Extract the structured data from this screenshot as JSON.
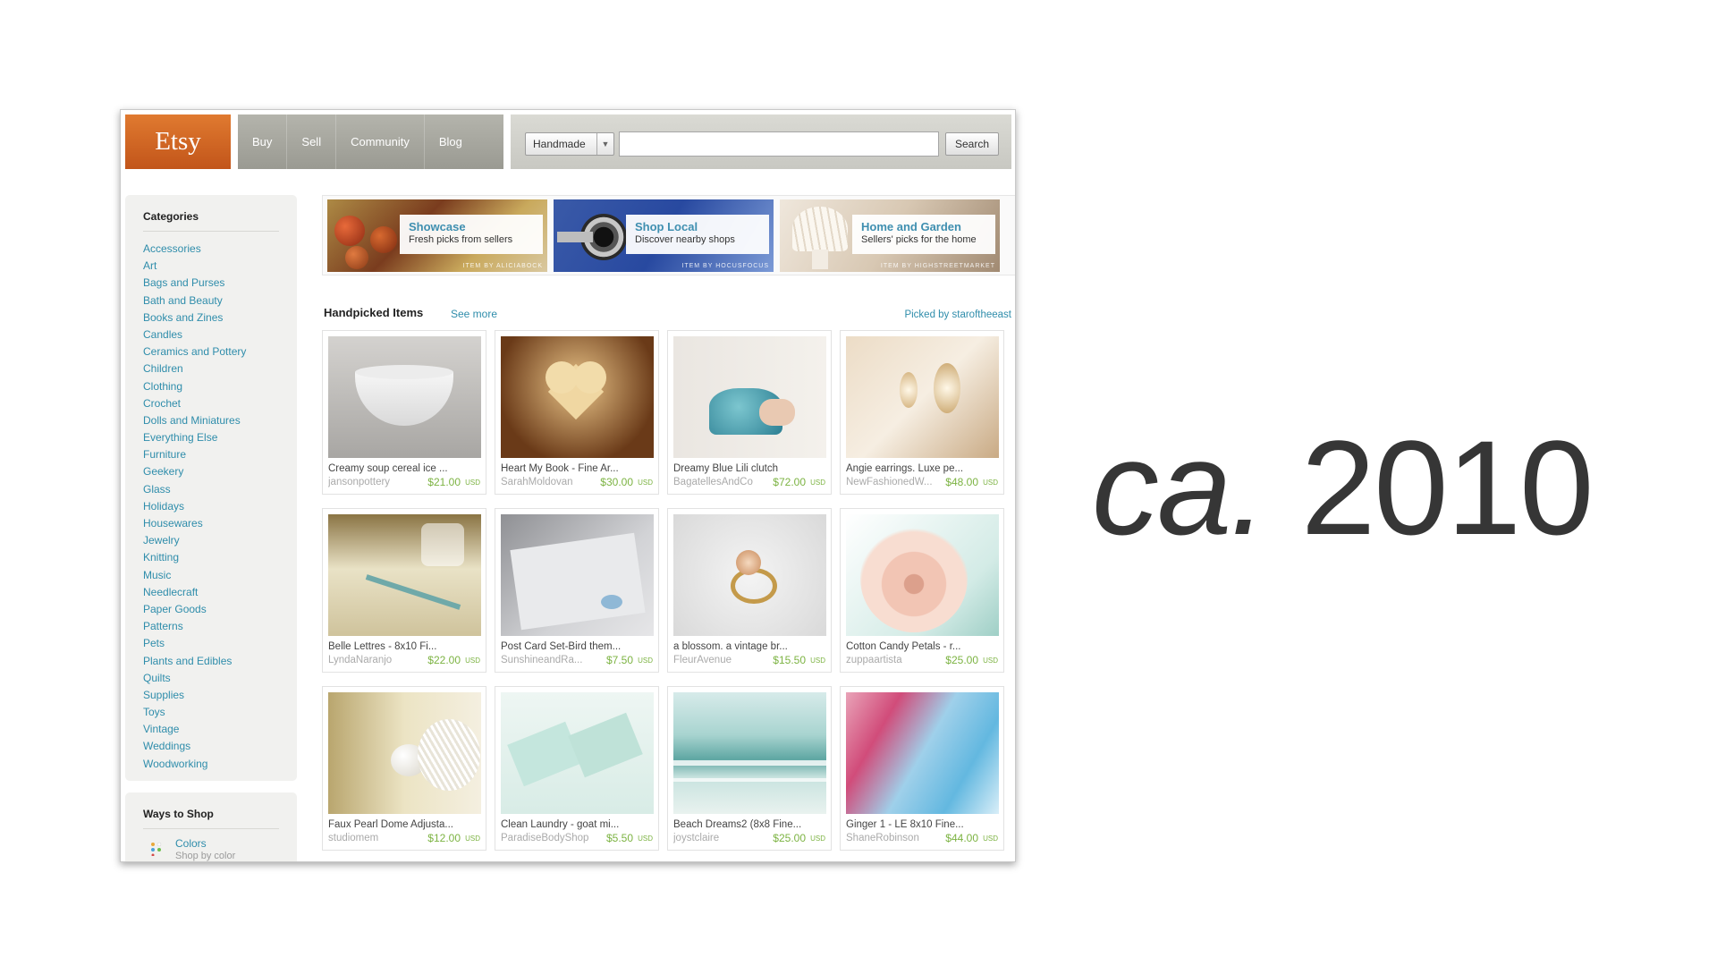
{
  "header": {
    "logo": "Etsy",
    "nav": [
      "Buy",
      "Sell",
      "Community",
      "Blog"
    ],
    "search_select": "Handmade",
    "search_value": "",
    "search_button": "Search"
  },
  "sidebar": {
    "categories_title": "Categories",
    "categories": [
      "Accessories",
      "Art",
      "Bags and Purses",
      "Bath and Beauty",
      "Books and Zines",
      "Candles",
      "Ceramics and Pottery",
      "Children",
      "Clothing",
      "Crochet",
      "Dolls and Miniatures",
      "Everything Else",
      "Furniture",
      "Geekery",
      "Glass",
      "Holidays",
      "Housewares",
      "Jewelry",
      "Knitting",
      "Music",
      "Needlecraft",
      "Paper Goods",
      "Patterns",
      "Pets",
      "Plants and Edibles",
      "Quilts",
      "Supplies",
      "Toys",
      "Vintage",
      "Weddings",
      "Woodworking"
    ],
    "ways_title": "Ways to Shop",
    "ways": [
      {
        "label": "Colors",
        "sub": "Shop by color"
      }
    ]
  },
  "banners": [
    {
      "title": "Showcase",
      "subtitle": "Fresh picks from sellers",
      "credit": "ITEM BY ALICIABOCK"
    },
    {
      "title": "Shop Local",
      "subtitle": "Discover nearby shops",
      "credit": "ITEM BY HOCUSFOCUS"
    },
    {
      "title": "Home and Garden",
      "subtitle": "Sellers' picks for the home",
      "credit": "ITEM BY HIGHSTREETMARKET"
    }
  ],
  "handpicked": {
    "title": "Handpicked Items",
    "see_more": "See more",
    "picked_by": "Picked by staroftheeast",
    "items": [
      {
        "title": "Creamy soup cereal ice ...",
        "shop": "jansonpottery",
        "price": "$21.00",
        "currency": "USD"
      },
      {
        "title": "Heart My Book - Fine Ar...",
        "shop": "SarahMoldovan",
        "price": "$30.00",
        "currency": "USD"
      },
      {
        "title": "Dreamy Blue Lili clutch",
        "shop": "BagatellesAndCo",
        "price": "$72.00",
        "currency": "USD"
      },
      {
        "title": "Angie earrings. Luxe pe...",
        "shop": "NewFashionedW...",
        "price": "$48.00",
        "currency": "USD"
      },
      {
        "title": "Belle Lettres - 8x10 Fi...",
        "shop": "LyndaNaranjo",
        "price": "$22.00",
        "currency": "USD"
      },
      {
        "title": "Post Card Set-Bird them...",
        "shop": "SunshineandRa...",
        "price": "$7.50",
        "currency": "USD"
      },
      {
        "title": "a blossom. a vintage br...",
        "shop": "FleurAvenue",
        "price": "$15.50",
        "currency": "USD"
      },
      {
        "title": "Cotton Candy Petals - r...",
        "shop": "zuppaartista",
        "price": "$25.00",
        "currency": "USD"
      },
      {
        "title": "Faux Pearl Dome Adjusta...",
        "shop": "studiomem",
        "price": "$12.00",
        "currency": "USD"
      },
      {
        "title": "Clean Laundry - goat mi...",
        "shop": "ParadiseBodyShop",
        "price": "$5.50",
        "currency": "USD"
      },
      {
        "title": "Beach Dreams2 (8x8 Fine...",
        "shop": "joystclaire",
        "price": "$25.00",
        "currency": "USD"
      },
      {
        "title": "Ginger 1 - LE 8x10 Fine...",
        "shop": "ShaneRobinson",
        "price": "$44.00",
        "currency": "USD"
      }
    ]
  },
  "caption": {
    "prefix": "ca.",
    "year": "2010"
  },
  "colors": {
    "brand": "#d5641f",
    "link": "#2f8dab",
    "price": "#7cb342"
  }
}
